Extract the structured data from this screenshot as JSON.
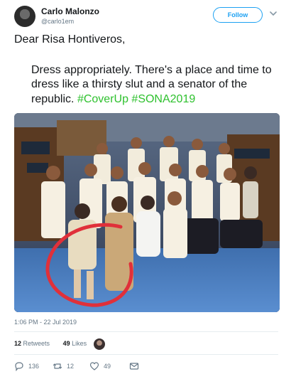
{
  "user": {
    "name": "Carlo Malonzo",
    "handle": "@carlo1em",
    "follow_label": "Follow"
  },
  "tweet": {
    "salutation": "Dear Risa Hontiveros,",
    "body": "Dress appropriately. There's a place and time to dress like a thirsty slut and a senator of the republic.",
    "hashtags": "#CoverUp #SONA2019",
    "timestamp": "1:06 PM - 22 Jul 2019"
  },
  "stats": {
    "retweets_count": "12",
    "retweets_label": "Retweets",
    "likes_count": "49",
    "likes_label": "Likes"
  },
  "actions": {
    "reply_count": "136",
    "retweet_count": "12",
    "like_count": "49"
  },
  "colors": {
    "accent": "#1da1f2",
    "hashtag": "#2ec12e",
    "annotation_circle": "#e0303a"
  },
  "icons": [
    "chevron-down-icon",
    "reply-icon",
    "retweet-icon",
    "like-icon",
    "message-icon"
  ]
}
